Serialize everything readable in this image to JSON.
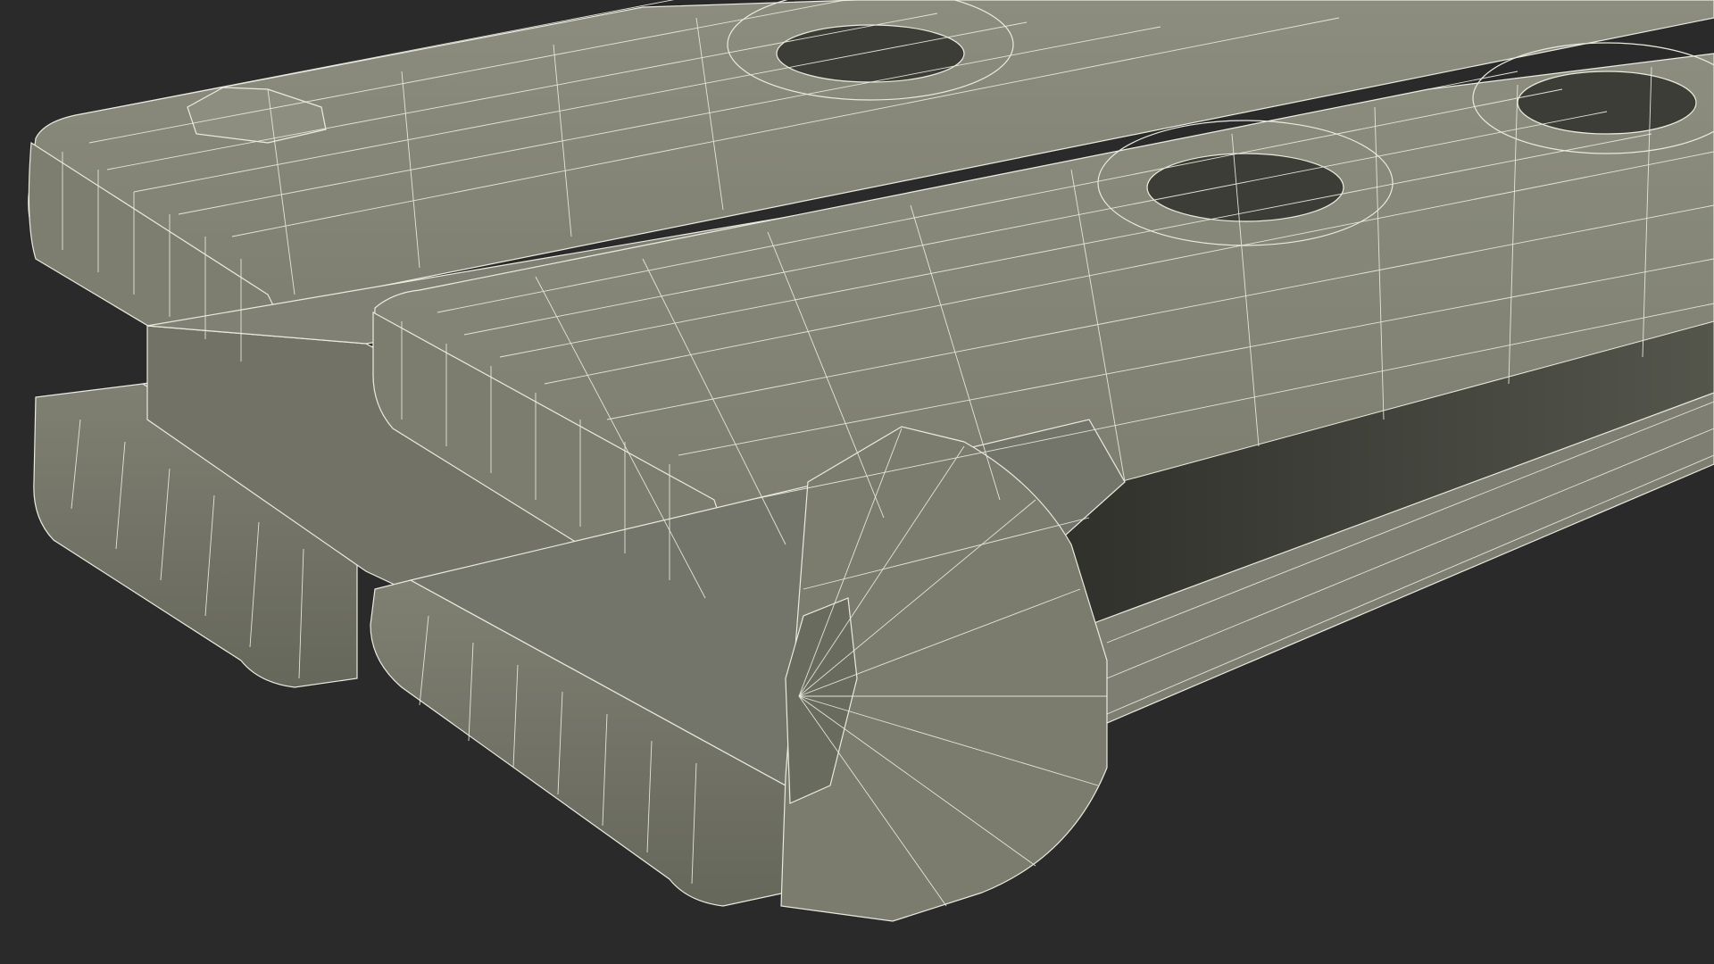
{
  "scene": {
    "subject": "wireframe-3d-model",
    "colors": {
      "background": "#2a2a2a",
      "surface_light": "#8a8b7c",
      "surface_mid": "#76776a",
      "surface_dark": "#5d5e53",
      "shadow": "#3f4039",
      "wire": "#e9ebde"
    }
  }
}
